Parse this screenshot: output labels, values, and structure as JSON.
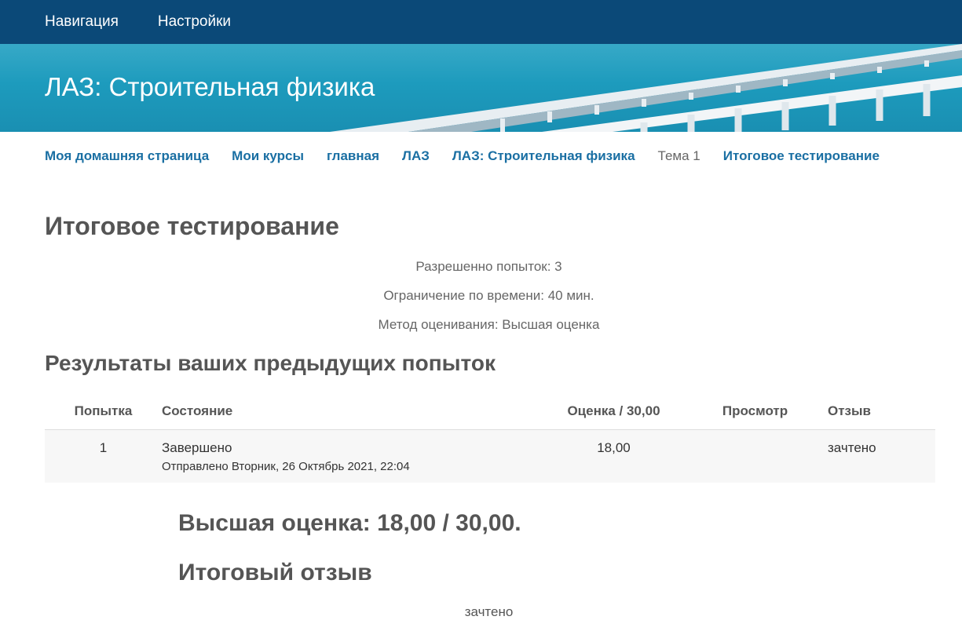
{
  "topnav": {
    "items": [
      "Навигация",
      "Настройки"
    ]
  },
  "banner": {
    "title": "ЛАЗ: Строительная физика"
  },
  "breadcrumb": {
    "links": [
      "Моя домашняя страница",
      "Мои курсы",
      "главная",
      "ЛАЗ",
      "ЛАЗ: Строительная физика"
    ],
    "current": "Тема 1",
    "last": "Итоговое тестирование"
  },
  "page": {
    "title": "Итоговое тестирование",
    "attempts_allowed": "Разрешенно попыток: 3",
    "time_limit": "Ограничение по времени: 40 мин.",
    "grading_method": "Метод оценивания: Высшая оценка"
  },
  "results": {
    "title": "Результаты ваших предыдущих попыток",
    "headers": {
      "attempt": "Попытка",
      "state": "Состояние",
      "grade": "Оценка / 30,00",
      "review": "Просмотр",
      "feedback": "Отзыв"
    },
    "rows": [
      {
        "attempt": "1",
        "state": "Завершено",
        "submitted": "Отправлено Вторник, 26 Октябрь 2021, 22:04",
        "grade": "18,00",
        "review": "",
        "feedback": "зачтено"
      }
    ]
  },
  "summary": {
    "best_grade": "Высшая оценка: 18,00 / 30,00.",
    "final_feedback_title": "Итоговый отзыв",
    "final_feedback": "зачтено"
  },
  "colors": {
    "topnav_bg": "#0b4978",
    "link": "#1a6fa3",
    "banner_sea": "#1d9bbd"
  }
}
